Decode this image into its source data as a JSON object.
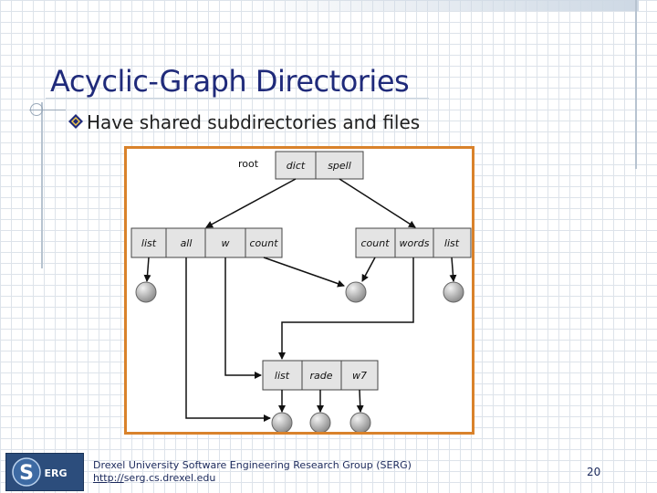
{
  "slide": {
    "title": "Acyclic-Graph Directories",
    "bullet": "Have shared subdirectories and files",
    "page_number": "20"
  },
  "diagram": {
    "root": {
      "label": "root",
      "entries": [
        "dict",
        "spell"
      ]
    },
    "left_dir": {
      "entries": [
        "list",
        "all",
        "w",
        "count"
      ]
    },
    "right_dir": {
      "entries": [
        "count",
        "words",
        "list"
      ]
    },
    "shared_dir": {
      "entries": [
        "list",
        "rade",
        "w7"
      ]
    },
    "colors": {
      "border": "#d9822b",
      "file_node": "#b8b8b8",
      "cell": "#e4e4e4"
    }
  },
  "footer": {
    "org": "Drexel University Software Engineering Research Group (SERG)",
    "url_scheme": "http://",
    "url_rest": "serg.cs.drexel.edu",
    "logo_text": "ERG",
    "logo_mark": "S"
  }
}
